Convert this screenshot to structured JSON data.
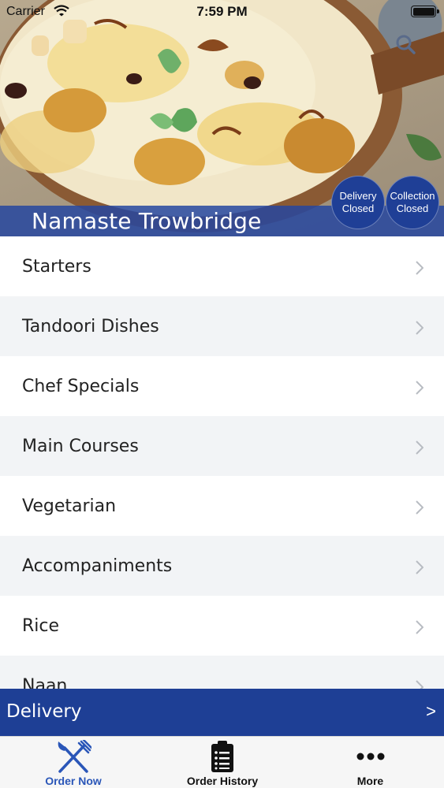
{
  "status_bar": {
    "carrier": "Carrier",
    "time": "7:59 PM"
  },
  "header": {
    "restaurant_name": "Namaste Trowbridge",
    "delivery_status": {
      "title": "Delivery",
      "state": "Closed"
    },
    "collection_status": {
      "title": "Collection",
      "state": "Closed"
    },
    "search_icon": "search-icon"
  },
  "menu": {
    "categories": [
      {
        "label": "Starters"
      },
      {
        "label": "Tandoori Dishes"
      },
      {
        "label": "Chef Specials"
      },
      {
        "label": "Main Courses"
      },
      {
        "label": "Vegetarian"
      },
      {
        "label": "Accompaniments"
      },
      {
        "label": "Rice"
      },
      {
        "label": "Naan"
      }
    ]
  },
  "delivery_bar": {
    "label": "Delivery",
    "arrow": ">"
  },
  "tabs": [
    {
      "label": "Order Now",
      "icon": "fork-knife-icon",
      "active": true
    },
    {
      "label": "Order History",
      "icon": "clipboard-list-icon",
      "active": false
    },
    {
      "label": "More",
      "icon": "more-dots-icon",
      "active": false
    }
  ],
  "colors": {
    "brand_blue": "#1e3f95",
    "active_tab": "#2a56b8",
    "row_alt": "#f2f4f6"
  }
}
